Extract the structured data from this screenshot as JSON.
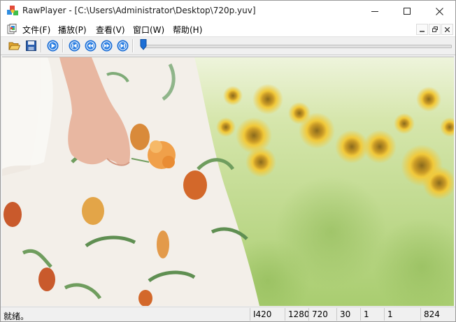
{
  "window": {
    "title": "RawPlayer - [C:\\Users\\Administrator\\Desktop\\720p.yuv]",
    "icon": "rawplayer-app-icon"
  },
  "title_buttons": [
    {
      "name": "minimize-button",
      "icon": "minimize-icon"
    },
    {
      "name": "maximize-button",
      "icon": "maximize-icon"
    },
    {
      "name": "close-button",
      "icon": "close-icon"
    }
  ],
  "menu": {
    "items": [
      "文件(F)",
      "播放(P)",
      "查看(V)",
      "窗口(W)",
      "帮助(H)"
    ],
    "mdi_buttons": [
      "child-minimize-icon",
      "child-restore-icon",
      "child-close-icon"
    ]
  },
  "toolbar": {
    "buttons": [
      {
        "name": "open-button",
        "icon": "folder-open-icon"
      },
      {
        "name": "save-button",
        "icon": "floppy-disk-icon"
      },
      {
        "name": "play-button",
        "icon": "play-icon"
      },
      {
        "name": "first-frame-button",
        "icon": "skip-to-start-icon"
      },
      {
        "name": "previous-frame-button",
        "icon": "step-back-icon"
      },
      {
        "name": "next-frame-button",
        "icon": "step-forward-icon"
      },
      {
        "name": "last-frame-button",
        "icon": "skip-to-end-icon"
      }
    ],
    "seek_position": 0
  },
  "video": {
    "description": "video frame",
    "colors": {
      "sky": "#eef4dc",
      "field": "#b9d67c",
      "sunflower": "#f1c93a",
      "dress": "#f3efe9",
      "skin": "#e8b7a1"
    }
  },
  "status": {
    "message": "就绪。",
    "format": "I420",
    "width": "1280",
    "height": "720",
    "fps": "30",
    "field1": "1",
    "field2": "1",
    "frame": "824"
  },
  "accent_color": "#1c6fd6"
}
